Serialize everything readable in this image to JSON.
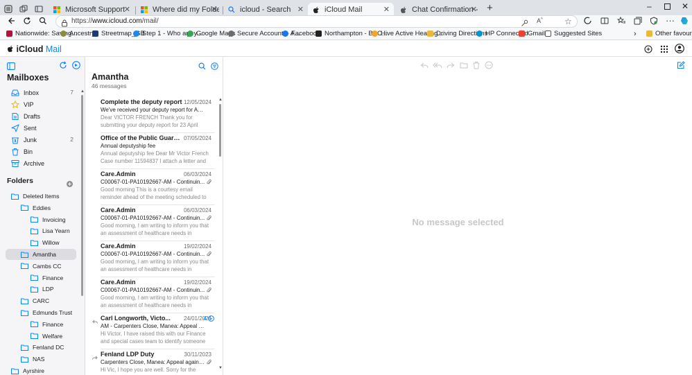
{
  "browser": {
    "tabs": [
      {
        "label": "Microsoft Support",
        "active": false
      },
      {
        "label": "Where did my Folder go? - Micr",
        "active": false
      },
      {
        "label": "icloud - Search",
        "active": false
      },
      {
        "label": "iCloud Mail",
        "active": true
      },
      {
        "label": "Chat Confirmation - Apple Supp",
        "active": false
      }
    ],
    "url_prefix": "https://",
    "url_host": "www.icloud.com",
    "url_path": "/mail/",
    "bookmarks": [
      {
        "label": "Nationwide: Saving...",
        "color": "#b5123e"
      },
      {
        "label": "Ancestry",
        "color": "#8a8d3c"
      },
      {
        "label": "Streetmap_GB",
        "color": "#1f3b73"
      },
      {
        "label": "Step 1 - Who are y...",
        "color": "#1e88e5"
      },
      {
        "label": "Google Maps",
        "color": "#34a853"
      },
      {
        "label": "Secure Account – A...",
        "color": "#6d6d6d"
      },
      {
        "label": "Facebook",
        "color": "#1877f2"
      },
      {
        "label": "Northampton - BBC...",
        "color": "#222222"
      },
      {
        "label": "Hive Active Heating...",
        "color": "#f5a623"
      },
      {
        "label": "Driving Directions",
        "color": "#e8b93b"
      },
      {
        "label": "HP Connected",
        "color": "#0096d6"
      },
      {
        "label": "Gmail",
        "color": "#ea4335"
      },
      {
        "label": "Suggested Sites",
        "color": "#555555"
      }
    ],
    "other_favourites": "Other favourites"
  },
  "app": {
    "brand": "iCloud",
    "brand_suffix": "Mail",
    "accent": "#0a84ff"
  },
  "sidebar": {
    "mailboxes_title": "Mailboxes",
    "mailboxes": [
      {
        "label": "Inbox",
        "count": "7",
        "icon": "inbox-icon"
      },
      {
        "label": "VIP",
        "count": "",
        "icon": "star-icon"
      },
      {
        "label": "Drafts",
        "count": "",
        "icon": "draft-icon"
      },
      {
        "label": "Sent",
        "count": "",
        "icon": "sent-icon"
      },
      {
        "label": "Junk",
        "count": "2",
        "icon": "junk-icon"
      },
      {
        "label": "Bin",
        "count": "",
        "icon": "bin-icon"
      },
      {
        "label": "Archive",
        "count": "",
        "icon": "archive-icon"
      }
    ],
    "folders_title": "Folders",
    "folders": [
      {
        "label": "Deleted Items",
        "level": 0,
        "selected": false
      },
      {
        "label": "Eddies",
        "level": 1,
        "selected": false
      },
      {
        "label": "Invoicing",
        "level": 2,
        "selected": false
      },
      {
        "label": "Lisa Yearn",
        "level": 2,
        "selected": false
      },
      {
        "label": "Willow",
        "level": 2,
        "selected": false
      },
      {
        "label": "Amantha",
        "level": 1,
        "selected": true
      },
      {
        "label": "Cambs CC",
        "level": 1,
        "selected": false
      },
      {
        "label": "Finance",
        "level": 2,
        "selected": false
      },
      {
        "label": "LDP",
        "level": 2,
        "selected": false
      },
      {
        "label": "CARC",
        "level": 1,
        "selected": false
      },
      {
        "label": "Edmunds Trust",
        "level": 1,
        "selected": false
      },
      {
        "label": "Finance",
        "level": 2,
        "selected": false
      },
      {
        "label": "Welfare",
        "level": 2,
        "selected": false
      },
      {
        "label": "Fenland DC",
        "level": 1,
        "selected": false
      },
      {
        "label": "NAS",
        "level": 1,
        "selected": false
      },
      {
        "label": "Ayrshire",
        "level": 0,
        "selected": false
      }
    ]
  },
  "message_list": {
    "title": "Amantha",
    "count_text": "46 messages",
    "messages": [
      {
        "sender": "Complete the deputy report",
        "date": "12/05/2024",
        "subject": "We've received your deputy report for Aman...",
        "preview": "Dear VICTOR FRENCH Thank you for submitting your deputy report for 23 April",
        "attachment": false,
        "replied": false,
        "forwarded": false,
        "thread_count": ""
      },
      {
        "sender": "Office of the Public Guard...",
        "date": "07/05/2024",
        "subject": "Annual deputyship fee",
        "preview": "Annual deputyship fee Dear Mr Victor French Case number 11594837 I attach a letter and",
        "attachment": false,
        "replied": false,
        "forwarded": false,
        "thread_count": ""
      },
      {
        "sender": "Care.Admin",
        "date": "06/03/2024",
        "subject": "C00067-01-PA10192667-AM - Continuin...",
        "preview": "Good morning This is a courtesy email reminder ahead of the meeting scheduled to",
        "attachment": true,
        "replied": false,
        "forwarded": false,
        "thread_count": ""
      },
      {
        "sender": "Care.Admin",
        "date": "06/03/2024",
        "subject": "C00067-01-PA10192667-AM - Continuin...",
        "preview": "Good morning, I am writing to inform you that an assessment of healthcare needs in relation",
        "attachment": true,
        "replied": false,
        "forwarded": false,
        "thread_count": ""
      },
      {
        "sender": "Care.Admin",
        "date": "19/02/2024",
        "subject": "C00067-01-PA10192667-AM - Continuin...",
        "preview": "Good morning, I am writing to inform you that an assessment of healthcare needs in relation",
        "attachment": true,
        "replied": false,
        "forwarded": false,
        "thread_count": ""
      },
      {
        "sender": "Care.Admin",
        "date": "19/02/2024",
        "subject": "C00067-01-PA10192667-AM - Continuin...",
        "preview": "Good morning, I am writing to inform you that an assessment of healthcare needs in relation",
        "attachment": true,
        "replied": false,
        "forwarded": false,
        "thread_count": ""
      },
      {
        "sender": "Carl Longworth, Victo...",
        "date": "24/01/2024",
        "subject": "AM - Carpenters Close, Manea: Appeal ag...",
        "preview": "Hi Victor, I have raised this with our Finance and special cases team to identify someone",
        "attachment": false,
        "replied": true,
        "forwarded": false,
        "thread_count": "4"
      },
      {
        "sender": "Fenland LDP Duty",
        "date": "30/11/2023",
        "subject": "Carpenters Close, Manea: Appeal against ...",
        "preview": "Hi Vic, I hope you are well. Sorry for the delay",
        "attachment": true,
        "replied": false,
        "forwarded": true,
        "thread_count": ""
      }
    ]
  },
  "reading_pane": {
    "empty_text": "No message selected"
  }
}
